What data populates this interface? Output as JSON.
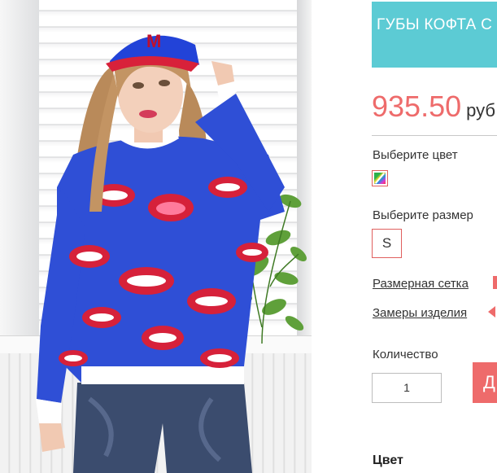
{
  "product": {
    "title": "ГУБЫ КОФТА С",
    "price": "935.50",
    "currency": "руб"
  },
  "options": {
    "color_label": "Выберите цвет",
    "size_label": "Выберите размер",
    "size_value": "S",
    "size_chart_link": "Размерная сетка",
    "measurements_link": "Замеры изделия"
  },
  "cart": {
    "quantity_label": "Количество",
    "quantity_value": "1",
    "add_button_label": "Д"
  },
  "details": {
    "color_heading": "Цвет"
  },
  "colors": {
    "accent": "#5ccbd4",
    "price": "#ee6b6b",
    "highlight": "#e0605e"
  },
  "icons": {
    "color_swatch": "multicolor-swatch-icon",
    "size_chart_marker": "red-square-icon",
    "measurements_marker": "red-arrow-icon"
  }
}
